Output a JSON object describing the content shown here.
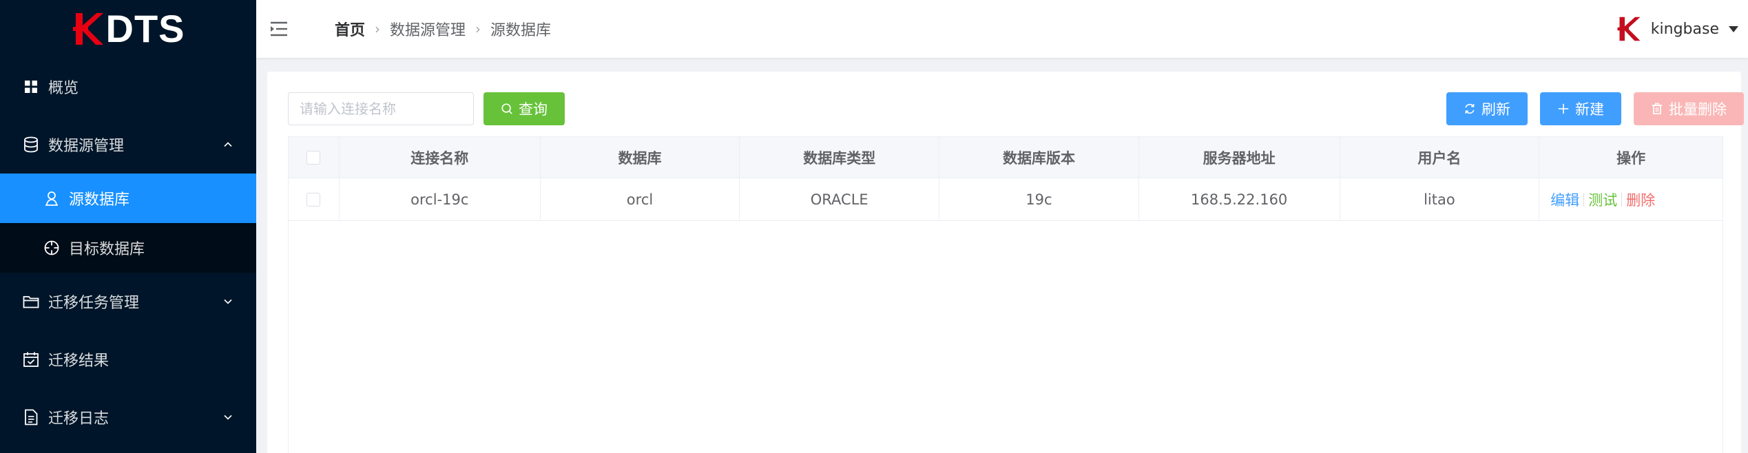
{
  "brand": {
    "logo_text": "DTS",
    "accent": "#e60012"
  },
  "sidebar": {
    "bg": "#001529",
    "active_color": "#1890ff",
    "items": [
      {
        "label": "概览",
        "icon": "grid-icon"
      },
      {
        "label": "数据源管理",
        "icon": "database-icon",
        "expanded": true,
        "children": [
          {
            "label": "源数据库",
            "icon": "user-icon",
            "active": true
          },
          {
            "label": "目标数据库",
            "icon": "target-icon"
          }
        ]
      },
      {
        "label": "迁移任务管理",
        "icon": "folder-icon"
      },
      {
        "label": "迁移结果",
        "icon": "calendar-check-icon"
      },
      {
        "label": "迁移日志",
        "icon": "document-icon"
      }
    ]
  },
  "header": {
    "breadcrumb": [
      "首页",
      "数据源管理",
      "源数据库"
    ],
    "user": {
      "name": "kingbase"
    }
  },
  "toolbar": {
    "search_placeholder": "请输入连接名称",
    "search_value": "",
    "query_label": "查询",
    "refresh_label": "刷新",
    "new_label": "新建",
    "bulk_delete_label": "批量删除"
  },
  "table": {
    "columns": [
      "连接名称",
      "数据库",
      "数据库类型",
      "数据库版本",
      "服务器地址",
      "用户名",
      "操作"
    ],
    "rows": [
      {
        "name": "orcl-19c",
        "database": "orcl",
        "db_type": "ORACLE",
        "version": "19c",
        "host": "168.5.22.160",
        "username": "litao",
        "actions": {
          "edit": "编辑",
          "test": "测试",
          "delete": "删除"
        }
      }
    ]
  }
}
